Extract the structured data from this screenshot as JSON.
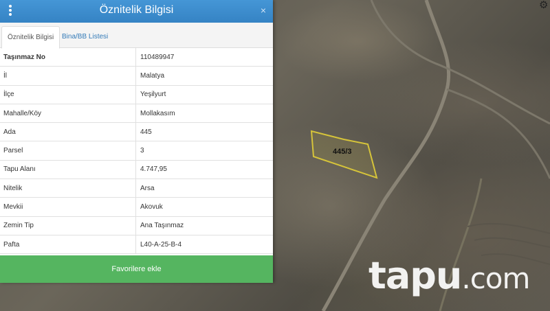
{
  "panel": {
    "title": "Öznitelik Bilgisi",
    "close_label": "×",
    "tabs": [
      "Öznitelik Bilgisi",
      "Bina/BB Listesi"
    ],
    "rows": [
      {
        "key": "Taşınmaz No",
        "value": "110489947"
      },
      {
        "key": "İl",
        "value": "Malatya"
      },
      {
        "key": "İlçe",
        "value": "Yeşilyurt"
      },
      {
        "key": "Mahalle/Köy",
        "value": "Mollakasım"
      },
      {
        "key": "Ada",
        "value": "445"
      },
      {
        "key": "Parsel",
        "value": "3"
      },
      {
        "key": "Tapu Alanı",
        "value": "4.747,95"
      },
      {
        "key": "Nitelik",
        "value": "Arsa"
      },
      {
        "key": "Mevkii",
        "value": "Akovuk"
      },
      {
        "key": "Zemin Tip",
        "value": "Ana Taşınmaz"
      },
      {
        "key": "Pafta",
        "value": "L40-A-25-B-4"
      }
    ],
    "favorite_button": "Favorilere ekle"
  },
  "map": {
    "parcel_label": "445/3",
    "parcel_color": "#d6c43a",
    "watermark_main": "tapu",
    "watermark_suffix": ".com"
  },
  "icons": {
    "menu": "kebab-menu-icon",
    "settings": "gear-icon",
    "close": "close-icon"
  }
}
